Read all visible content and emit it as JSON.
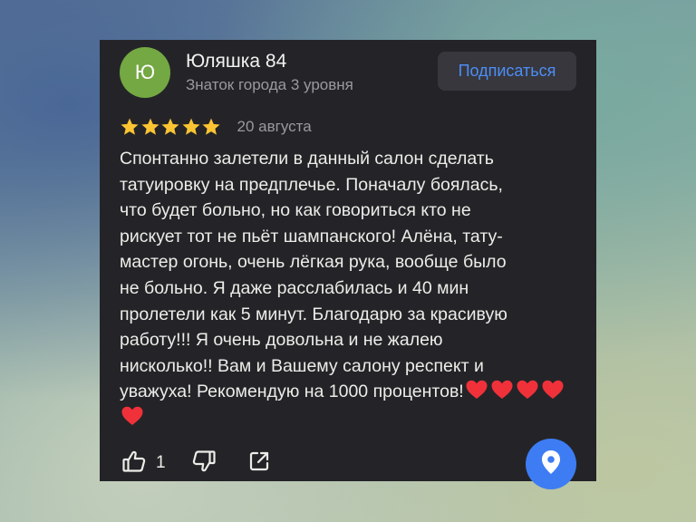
{
  "colors": {
    "card_background": "#242428",
    "avatar_background": "#74a843",
    "accent_blue": "#4d8ef5",
    "subscribe_button_background": "#37373d",
    "star_color": "#fcc433",
    "heart_color": "#f0313a",
    "fab_background": "#3d7cf3"
  },
  "author": {
    "avatar_letter": "Ю",
    "name": "Юляшка 84",
    "level": "Знаток города 3 уровня"
  },
  "subscribe_button": {
    "label": "Подписаться"
  },
  "review": {
    "stars": 5,
    "date": "20 августа",
    "text": "Спонтанно залетели в данный салон сделать\nтатуировку на предплечье. Поначалу боялась,\nчто будет больно, но как говориться кто не\nрискует тот не пьёт шампанского! Алёна, тату-\nмастер огонь, очень лёгкая рука, вообще было\nне больно. Я даже расслабилась и 40 мин\nпролетели как 5 минут. Благодарю за красивую\nработу!!! Я очень довольна и не жалею\nнисколько!! Вам и Вашему салону респект и\nуважуха! Рекомендую на 1000 процентов!",
    "trailing_emoji": [
      "heart",
      "heart",
      "heart",
      "heart",
      "heart"
    ]
  },
  "actions": {
    "like_icon": "thumbs-up-icon",
    "like_count": "1",
    "dislike_icon": "thumbs-down-icon",
    "share_icon": "share-icon"
  },
  "map_button": {
    "icon": "map-pin-icon"
  }
}
